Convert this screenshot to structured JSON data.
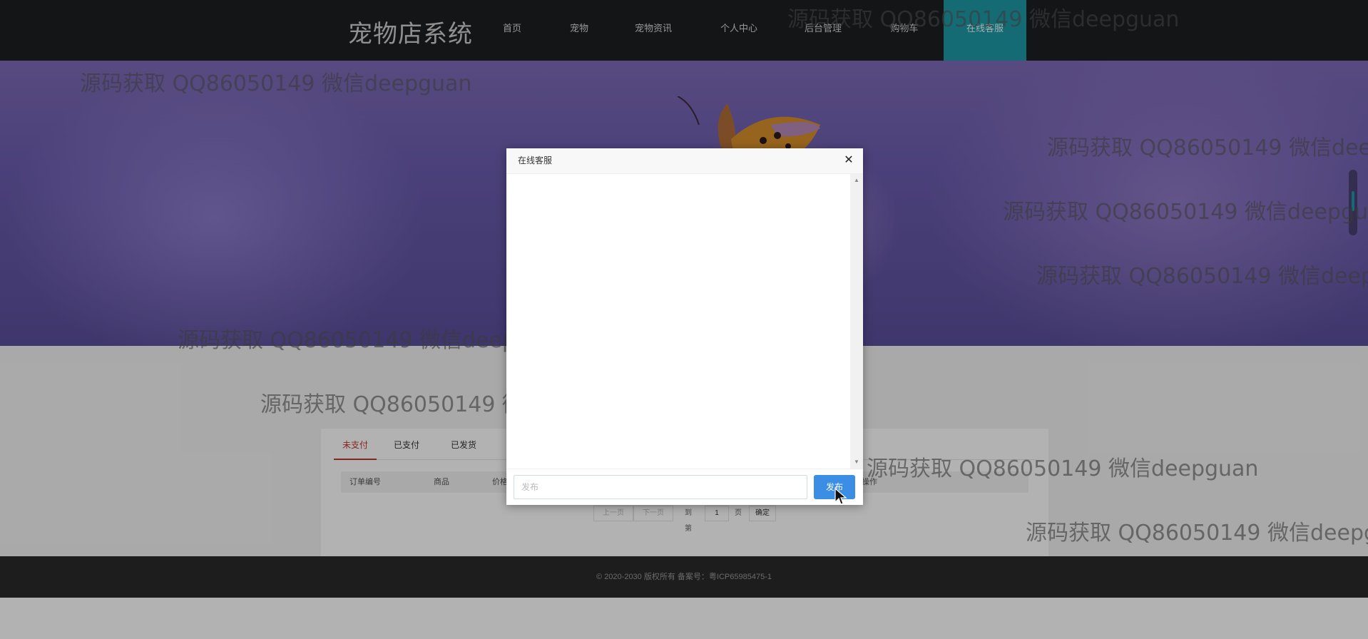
{
  "header": {
    "brand": "宠物店系统",
    "nav": [
      {
        "label": "首页"
      },
      {
        "label": "宠物"
      },
      {
        "label": "宠物资讯"
      },
      {
        "label": "个人中心"
      },
      {
        "label": "后台管理"
      },
      {
        "label": "购物车"
      },
      {
        "label": "在线客服",
        "active": true
      }
    ]
  },
  "orders": {
    "tabs": [
      {
        "label": "未支付",
        "active": true
      },
      {
        "label": "已支付"
      },
      {
        "label": "已发货"
      }
    ],
    "columns": [
      "订单编号",
      "商品",
      "价格",
      "操作"
    ],
    "pager": {
      "prev": "上一页",
      "next": "下一页",
      "goto_label": "到第",
      "page_value": "1",
      "page_unit": "页",
      "confirm": "确定"
    }
  },
  "footer": {
    "text": "© 2020-2030 版权所有 备案号：粤ICP65985475-1"
  },
  "dialog": {
    "title": "在线客服",
    "close_icon": "close-icon",
    "input_placeholder": "发布",
    "input_value": "",
    "send_label": "发布"
  },
  "watermark": {
    "text": "源码获取 QQ86050149 微信deepguan"
  },
  "colors": {
    "header_bg": "#1e1f22",
    "nav_active": "#1d9aa5",
    "tab_active": "#c0392b",
    "send_button": "#3b8ee4",
    "footer_bg": "#2a2a2a"
  }
}
